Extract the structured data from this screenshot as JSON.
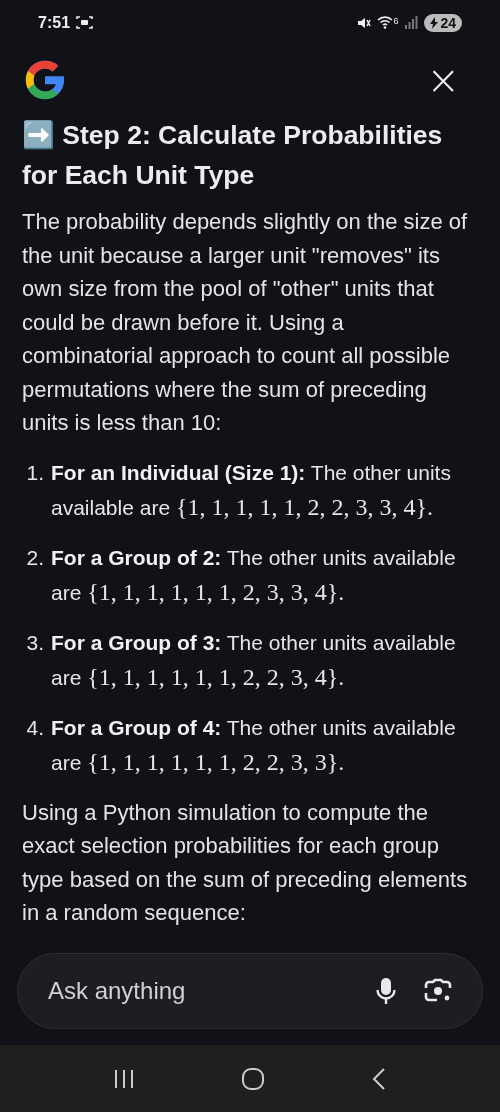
{
  "status_bar": {
    "time": "7:51",
    "wifi_label": "6",
    "battery": "24"
  },
  "header": {
    "close": "×"
  },
  "title": {
    "emoji": "➡️",
    "text": "Step 2: Calculate Probabilities for Each Unit Type"
  },
  "intro": "The probability depends slightly on the size of the unit because a larger unit \"removes\" its own size from the pool of \"other\" units that could be drawn before it. Using a combinatorial approach to count all possible permutations where the sum of preceding units is less than 10:",
  "list": [
    {
      "number": "1.",
      "lead": "For an Individual (Size 1):",
      "text": "The other units available are",
      "math": "{1, 1, 1, 1, 1, 2, 2, 3, 3, 4}."
    },
    {
      "number": "2.",
      "lead": "For a Group of 2:",
      "text": "The other units available are",
      "math": "{1, 1, 1, 1, 1, 1, 2, 3, 3, 4}."
    },
    {
      "number": "3.",
      "lead": "For a Group of 3:",
      "text": "The other units available are",
      "math": "{1, 1, 1, 1, 1, 1, 2, 2, 3, 4}."
    },
    {
      "number": "4.",
      "lead": "For a Group of 4:",
      "text": "The other units available are",
      "math": "{1, 1, 1, 1, 1, 1, 2, 2, 3, 3}."
    }
  ],
  "outro": "Using a Python simulation to compute the exact selection probabilities for each group type based on the sum of preceding elements in a random sequence:",
  "input": {
    "placeholder": "Ask anything"
  }
}
